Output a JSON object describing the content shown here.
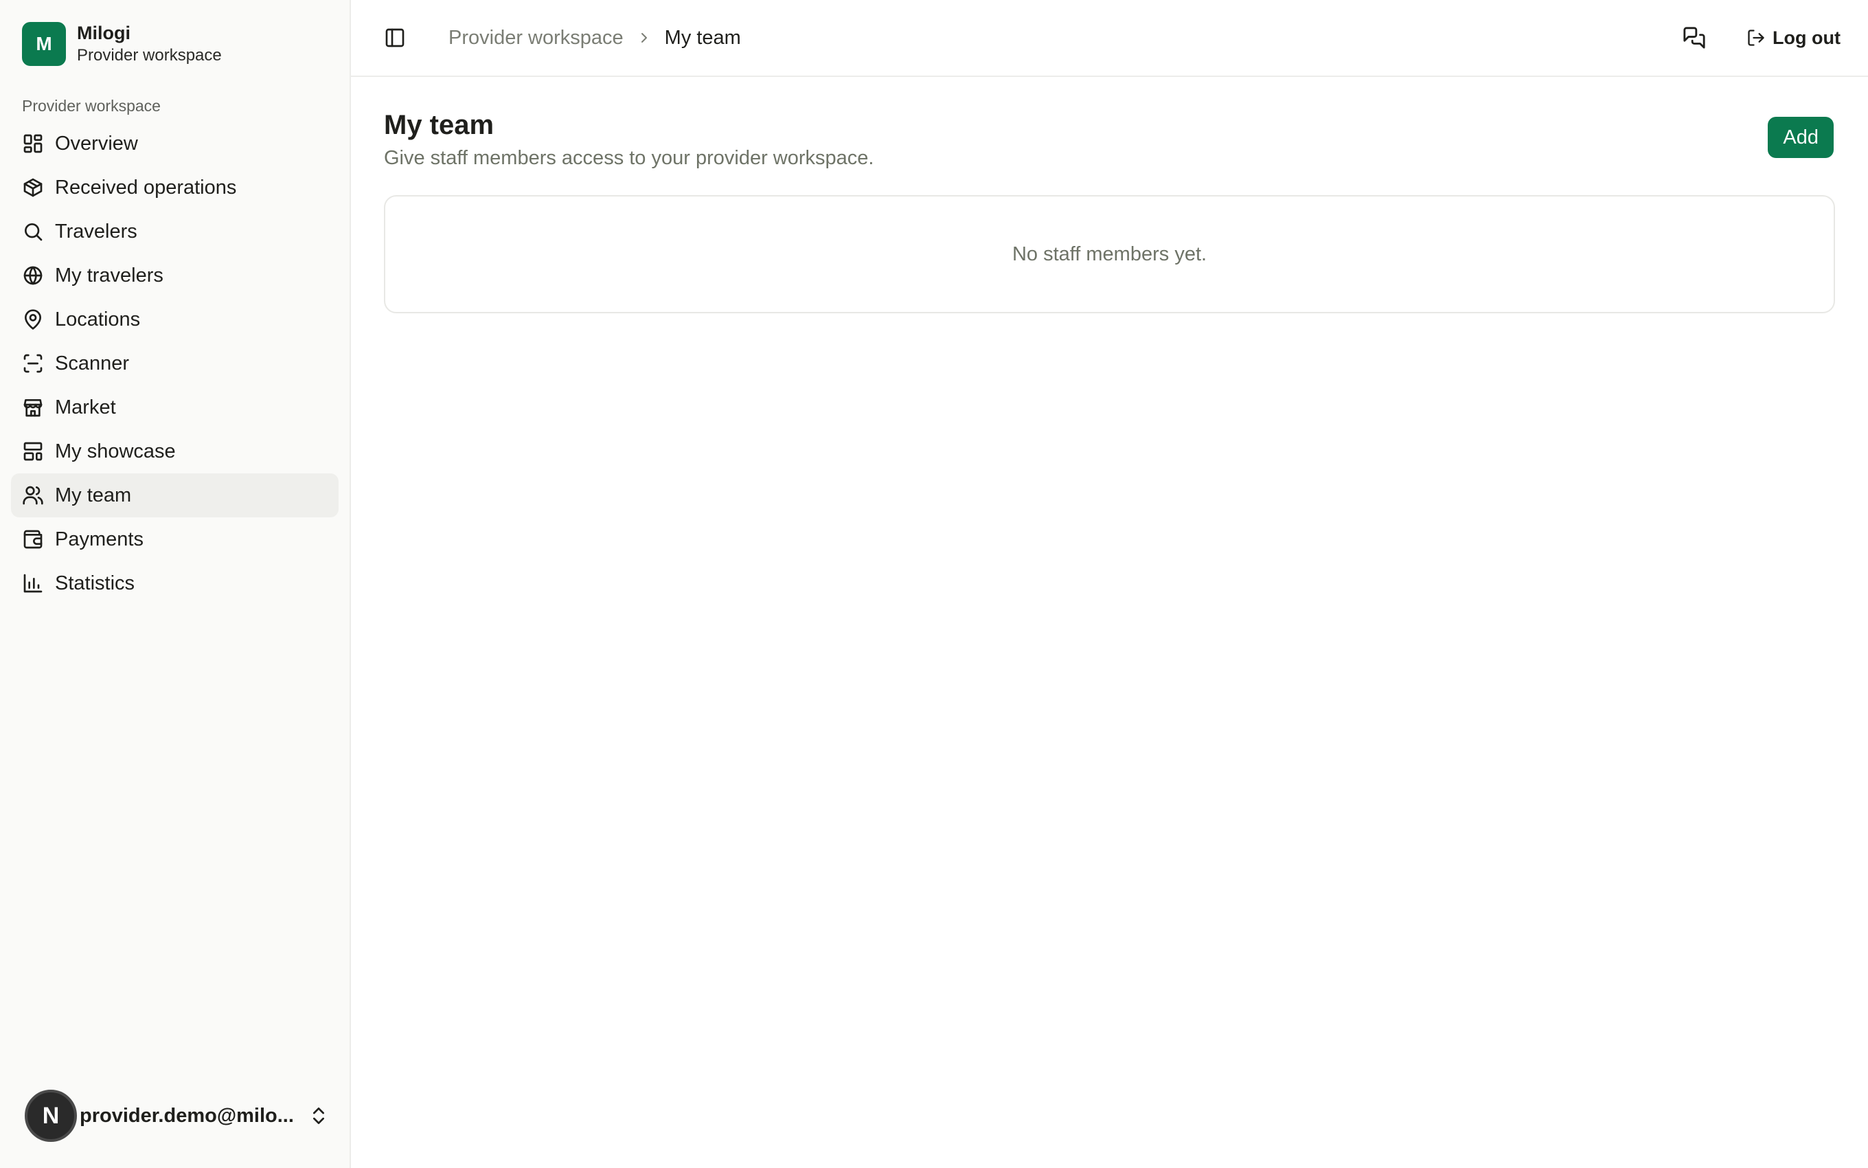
{
  "brand": {
    "initial": "M",
    "name": "Milogi",
    "subtitle": "Provider workspace"
  },
  "sidebar": {
    "group_label": "Provider workspace",
    "items": [
      {
        "label": "Overview",
        "icon": "dashboard-icon"
      },
      {
        "label": "Received operations",
        "icon": "package-icon"
      },
      {
        "label": "Travelers",
        "icon": "search-icon"
      },
      {
        "label": "My travelers",
        "icon": "globe-icon"
      },
      {
        "label": "Locations",
        "icon": "map-pin-icon"
      },
      {
        "label": "Scanner",
        "icon": "scan-icon"
      },
      {
        "label": "Market",
        "icon": "store-icon"
      },
      {
        "label": "My showcase",
        "icon": "layout-icon"
      },
      {
        "label": "My team",
        "icon": "users-icon",
        "active": true
      },
      {
        "label": "Payments",
        "icon": "wallet-icon"
      },
      {
        "label": "Statistics",
        "icon": "bar-chart-icon"
      }
    ]
  },
  "user": {
    "avatar_initial": "N",
    "email": "provider.demo@milo..."
  },
  "header": {
    "breadcrumb": {
      "parent": "Provider workspace",
      "current": "My team"
    },
    "logout_label": "Log out"
  },
  "page": {
    "title": "My team",
    "subtitle": "Give staff members access to your provider workspace.",
    "add_label": "Add",
    "empty_message": "No staff members yet."
  },
  "colors": {
    "accent": "#0b7a4f",
    "muted_text": "#6e7367",
    "sidebar_bg": "#fafaf8"
  }
}
